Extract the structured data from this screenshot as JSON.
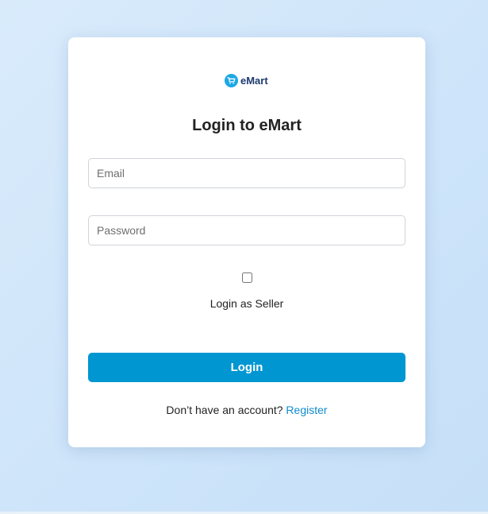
{
  "brand": {
    "name": "eMart",
    "icon": "shopping-cart-icon",
    "icon_color": "#1da8e6",
    "text_color": "#1c3a6e"
  },
  "login": {
    "title": "Login to eMart",
    "email_placeholder": "Email",
    "email_value": "",
    "password_placeholder": "Password",
    "password_value": "",
    "seller_checkbox_label": "Login as Seller",
    "seller_checked": false,
    "submit_label": "Login",
    "register_prompt": "Don’t have an account?",
    "register_link": "Register"
  },
  "colors": {
    "accent": "#0096d1",
    "link": "#0e8ccc",
    "background": "#d4e8fa"
  }
}
